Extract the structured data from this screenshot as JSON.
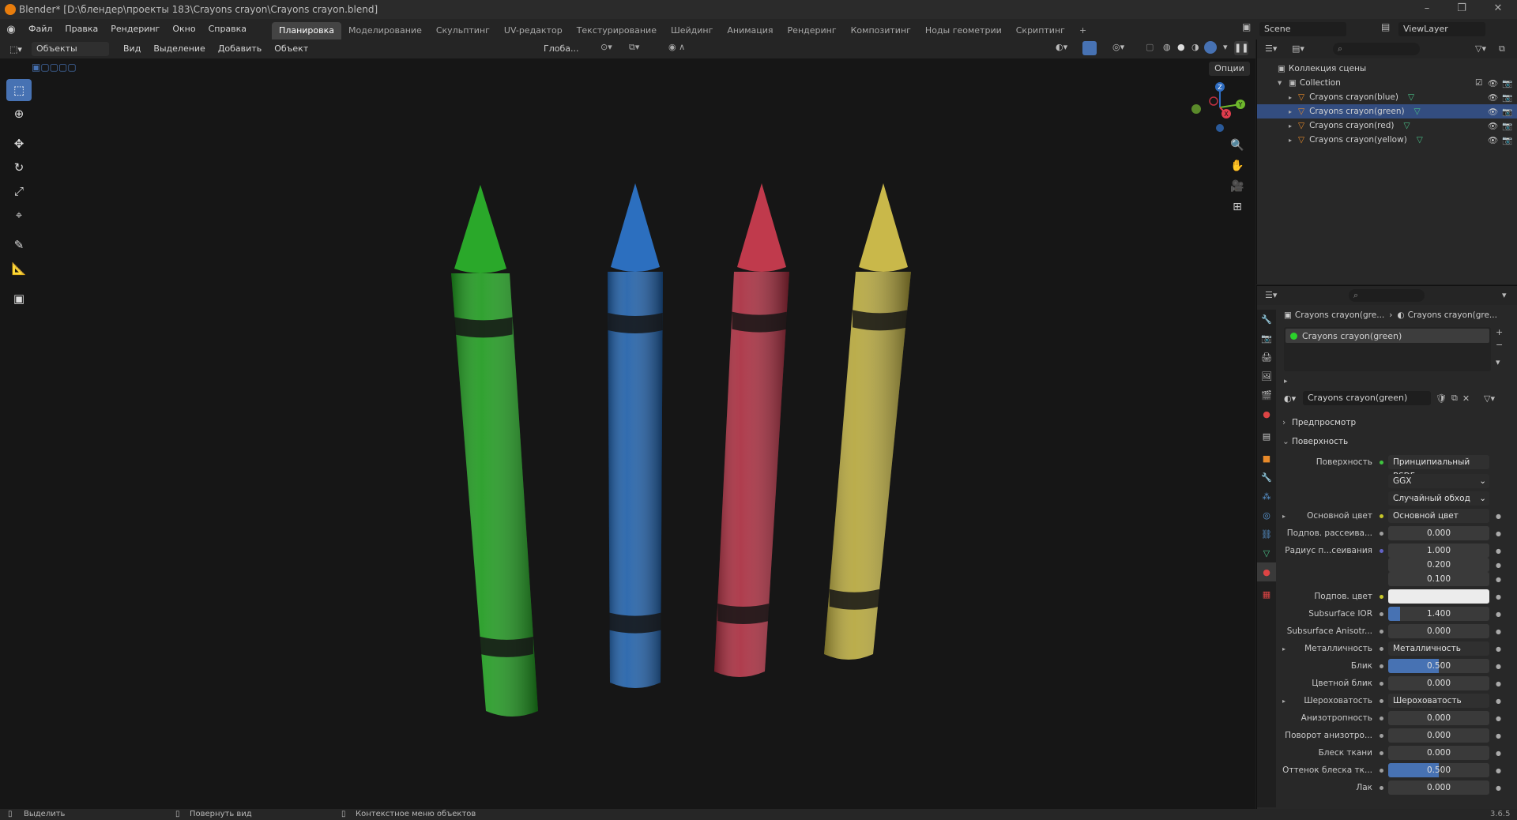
{
  "window": {
    "title": "Blender* [D:\\блендер\\проекты 183\\Crayons crayon\\Crayons crayon.blend]",
    "minimize": "–",
    "restore": "❐",
    "close": "✕"
  },
  "menu": [
    "Файл",
    "Правка",
    "Рендеринг",
    "Окно",
    "Справка"
  ],
  "workspaces": [
    "Планировка",
    "Моделирование",
    "Скульптинг",
    "UV-редактор",
    "Текстурирование",
    "Шейдинг",
    "Анимация",
    "Рендеринг",
    "Композитинг",
    "Ноды геометрии",
    "Скриптинг",
    "+"
  ],
  "scene": {
    "name": "Scene",
    "viewlayer": "ViewLayer"
  },
  "viewport_header": {
    "mode": "Объекты",
    "menus": [
      "Вид",
      "Выделение",
      "Добавить",
      "Объект"
    ],
    "orientation": "Глоба...",
    "options": "Опции"
  },
  "outliner": {
    "scene_collection": "Коллекция сцены",
    "collection": "Collection",
    "objects": [
      {
        "name": "Crayons crayon(blue)",
        "selected": false
      },
      {
        "name": "Crayons crayon(green)",
        "selected": true
      },
      {
        "name": "Crayons crayon(red)",
        "selected": false
      },
      {
        "name": "Crayons crayon(yellow)",
        "selected": false
      }
    ]
  },
  "crayons": [
    {
      "color": "#1f9a1f",
      "tip": "#2aa82a"
    },
    {
      "color": "#1f5fa8",
      "tip": "#2c6fbf"
    },
    {
      "color": "#a82c3e",
      "tip": "#c03a4c"
    },
    {
      "color": "#b5a63c",
      "tip": "#c9b84a"
    }
  ],
  "properties": {
    "breadcrumb": [
      "Crayons crayon(gre...",
      "Crayons crayon(gre..."
    ],
    "material_slot": "Crayons crayon(green)",
    "material_name": "Crayons crayon(green)",
    "panels": {
      "preview": "Предпросмотр",
      "surface": "Поверхность"
    },
    "surface_label": "Поверхность",
    "surface_value": "Принципиальный BSDF",
    "distribution": "GGX",
    "subsurface_method": "Случайный обход",
    "rows": [
      {
        "label": "Основной цвет",
        "value": "Основной цвет",
        "kind": "link",
        "dot": "#c7c729",
        "expander": true
      },
      {
        "label": "Подпов. рассеива...",
        "value": "0.000",
        "kind": "num",
        "dot": "#a0a0a0"
      },
      {
        "label": "Радиус п...сеивания",
        "value": "1.000",
        "kind": "num",
        "dot": "#6363c7"
      },
      {
        "label": "",
        "value": "0.200",
        "kind": "num",
        "dot": ""
      },
      {
        "label": "",
        "value": "0.100",
        "kind": "num",
        "dot": ""
      },
      {
        "label": "Подпов. цвет",
        "value": "",
        "kind": "color",
        "dot": "#c7c729"
      },
      {
        "label": "Subsurface IOR",
        "value": "1.400",
        "kind": "num",
        "dot": "#a0a0a0",
        "fill": 0.12
      },
      {
        "label": "Subsurface Anisotr...",
        "value": "0.000",
        "kind": "num",
        "dot": "#a0a0a0"
      },
      {
        "label": "Металличность",
        "value": "Металличность",
        "kind": "link",
        "dot": "#a0a0a0",
        "expander": true
      },
      {
        "label": "Блик",
        "value": "0.500",
        "kind": "num",
        "dot": "#a0a0a0",
        "fill": 0.5
      },
      {
        "label": "Цветной блик",
        "value": "0.000",
        "kind": "num",
        "dot": "#a0a0a0"
      },
      {
        "label": "Шероховатость",
        "value": "Шероховатость",
        "kind": "link",
        "dot": "#a0a0a0",
        "expander": true
      },
      {
        "label": "Анизотропность",
        "value": "0.000",
        "kind": "num",
        "dot": "#a0a0a0"
      },
      {
        "label": "Поворот анизотро...",
        "value": "0.000",
        "kind": "num",
        "dot": "#a0a0a0"
      },
      {
        "label": "Блеск ткани",
        "value": "0.000",
        "kind": "num",
        "dot": "#a0a0a0"
      },
      {
        "label": "Оттенок блеска тк...",
        "value": "0.500",
        "kind": "num",
        "dot": "#a0a0a0",
        "fill": 0.5
      },
      {
        "label": "Лак",
        "value": "0.000",
        "kind": "num",
        "dot": "#a0a0a0"
      }
    ]
  },
  "statusbar": {
    "select": "Выделить",
    "rotate": "Повернуть вид",
    "context": "Контекстное меню объектов",
    "version": "3.6.5"
  }
}
